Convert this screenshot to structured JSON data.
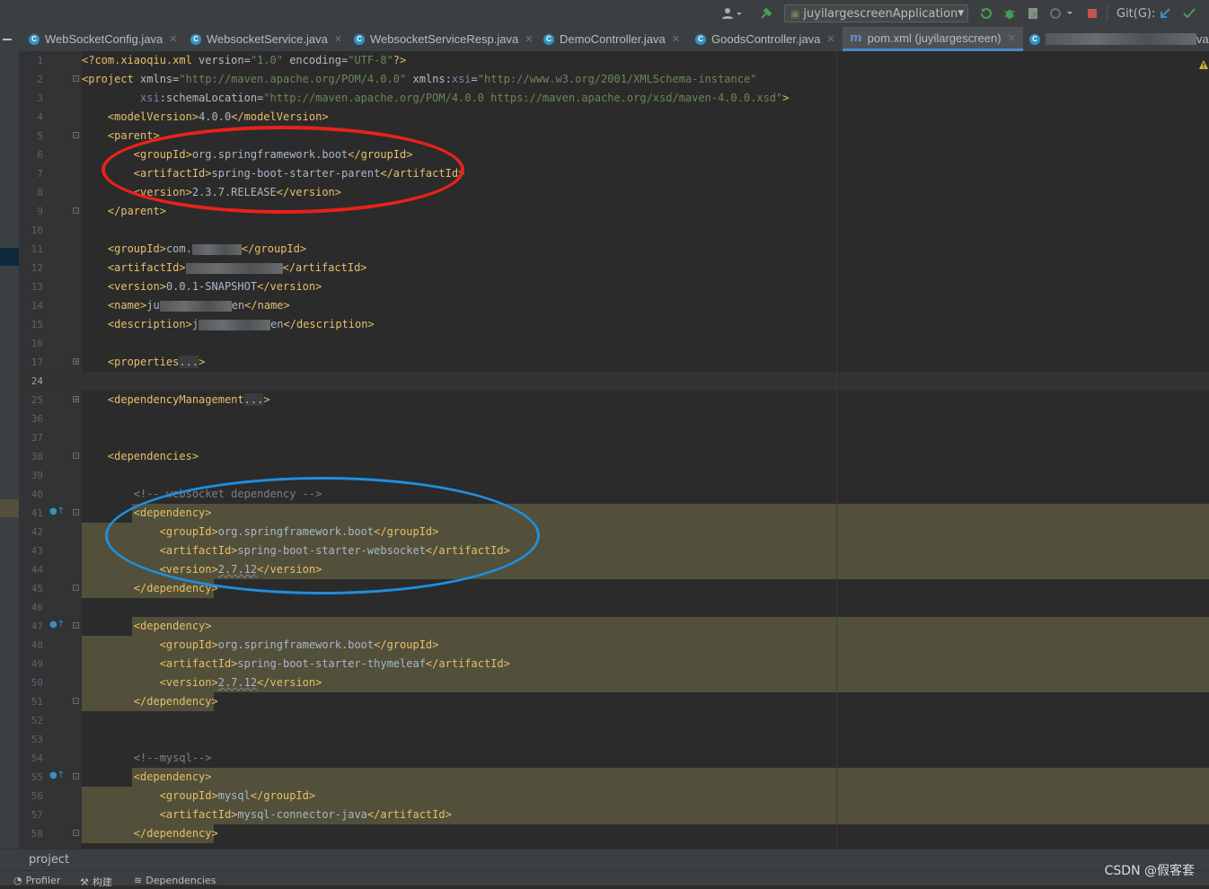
{
  "toolbar": {
    "run_config": "juyilargescreenApplication",
    "git_label": "Git(G):"
  },
  "tabs": [
    {
      "label": "WebSocketConfig.java"
    },
    {
      "label": "WebsocketService.java"
    },
    {
      "label": "WebsocketServiceResp.java"
    },
    {
      "label": "DemoController.java"
    },
    {
      "label": "GoodsController.java"
    },
    {
      "label": "pom.xml (juyilargescreen)"
    },
    {
      "label": "va"
    }
  ],
  "line_numbers": [
    "1",
    "2",
    "3",
    "4",
    "5",
    "6",
    "7",
    "8",
    "9",
    "10",
    "11",
    "12",
    "13",
    "14",
    "15",
    "16",
    "17",
    "24",
    "25",
    "36",
    "37",
    "38",
    "39",
    "40",
    "41",
    "42",
    "43",
    "44",
    "45",
    "46",
    "47",
    "48",
    "49",
    "50",
    "51",
    "52",
    "53",
    "54",
    "55",
    "56",
    "57",
    "58"
  ],
  "code": {
    "l1_a": "<?com.xiaoqiu.xml ",
    "l1_b": "version=",
    "l1_c": "\"1.0\"",
    "l1_d": " encoding=",
    "l1_e": "\"UTF-8\"",
    "l1_f": "?>",
    "l2_a": "<project ",
    "l2_b": "xmlns=",
    "l2_c": "\"http://maven.apache.org/POM/4.0.0\"",
    "l2_d": " xmlns:",
    "l2_e": "xsi",
    "l2_f": "=",
    "l2_g": "\"http://www.w3.org/2001/XMLSchema-instance\"",
    "l3_a": "xsi",
    "l3_b": ":schemaLocation=",
    "l3_c": "\"http://maven.apache.org/POM/4.0.0 https://maven.apache.org/xsd/maven-4.0.0.xsd\"",
    "l3_d": ">",
    "l4_a": "<modelVersion>",
    "l4_b": "4.0.0",
    "l4_c": "</modelVersion>",
    "l5": "<parent>",
    "l6_a": "<groupId>",
    "l6_b": "org.springframework.boot",
    "l6_c": "</groupId>",
    "l7_a": "<artifactId>",
    "l7_b": "spring-boot-starter-parent",
    "l7_c": "</artifactId>",
    "l8_a": "<version>",
    "l8_b": "2.3.7.RELEASE",
    "l8_c": "</version>",
    "l9": "</parent>",
    "l11_a": "<groupId>",
    "l11_b": "com.",
    "l11_c": "</groupId>",
    "l12_a": "<artifactId>",
    "l12_b": "</artifactId>",
    "l13_a": "<version>",
    "l13_b": "0.0.1-SNAPSHOT",
    "l13_c": "</version>",
    "l14_a": "<name>",
    "l14_b": "ju",
    "l14_c": "en",
    "l14_d": "</name>",
    "l15_a": "<description>",
    "l15_b": "j",
    "l15_c": "en",
    "l15_d": "</description>",
    "l17_a": "<properties",
    "l17_b": "...",
    "l17_c": ">",
    "l25_a": "<dependencyManagement",
    "l25_b": "...",
    "l25_c": ">",
    "l38": "<dependencies>",
    "l40": "<!-- websocket dependency -->",
    "dep_open": "<dependency>",
    "dep_close": "</dependency>",
    "g_open": "<groupId>",
    "g_close": "</groupId>",
    "a_open": "<artifactId>",
    "a_close": "</artifactId>",
    "v_open": "<version>",
    "v_close": "</version>",
    "springboot": "org.springframework.boot",
    "websocket": "spring-boot-starter-websocket",
    "ver_2712": "2.7.12",
    "thymeleaf": "spring-boot-starter-thymeleaf",
    "l54": "<!--mysql-->",
    "mysql": "mysql",
    "mysql_conn": "mysql-connector-java"
  },
  "status": {
    "breadcrumb": "project",
    "profiler": "Profiler",
    "build": "构建",
    "dependencies": "Dependencies",
    "watermark": "CSDN @假客套"
  },
  "colors": {
    "annotation_red": "#e8221b",
    "annotation_blue": "#1e8fe0",
    "highlight": "#52503a"
  }
}
